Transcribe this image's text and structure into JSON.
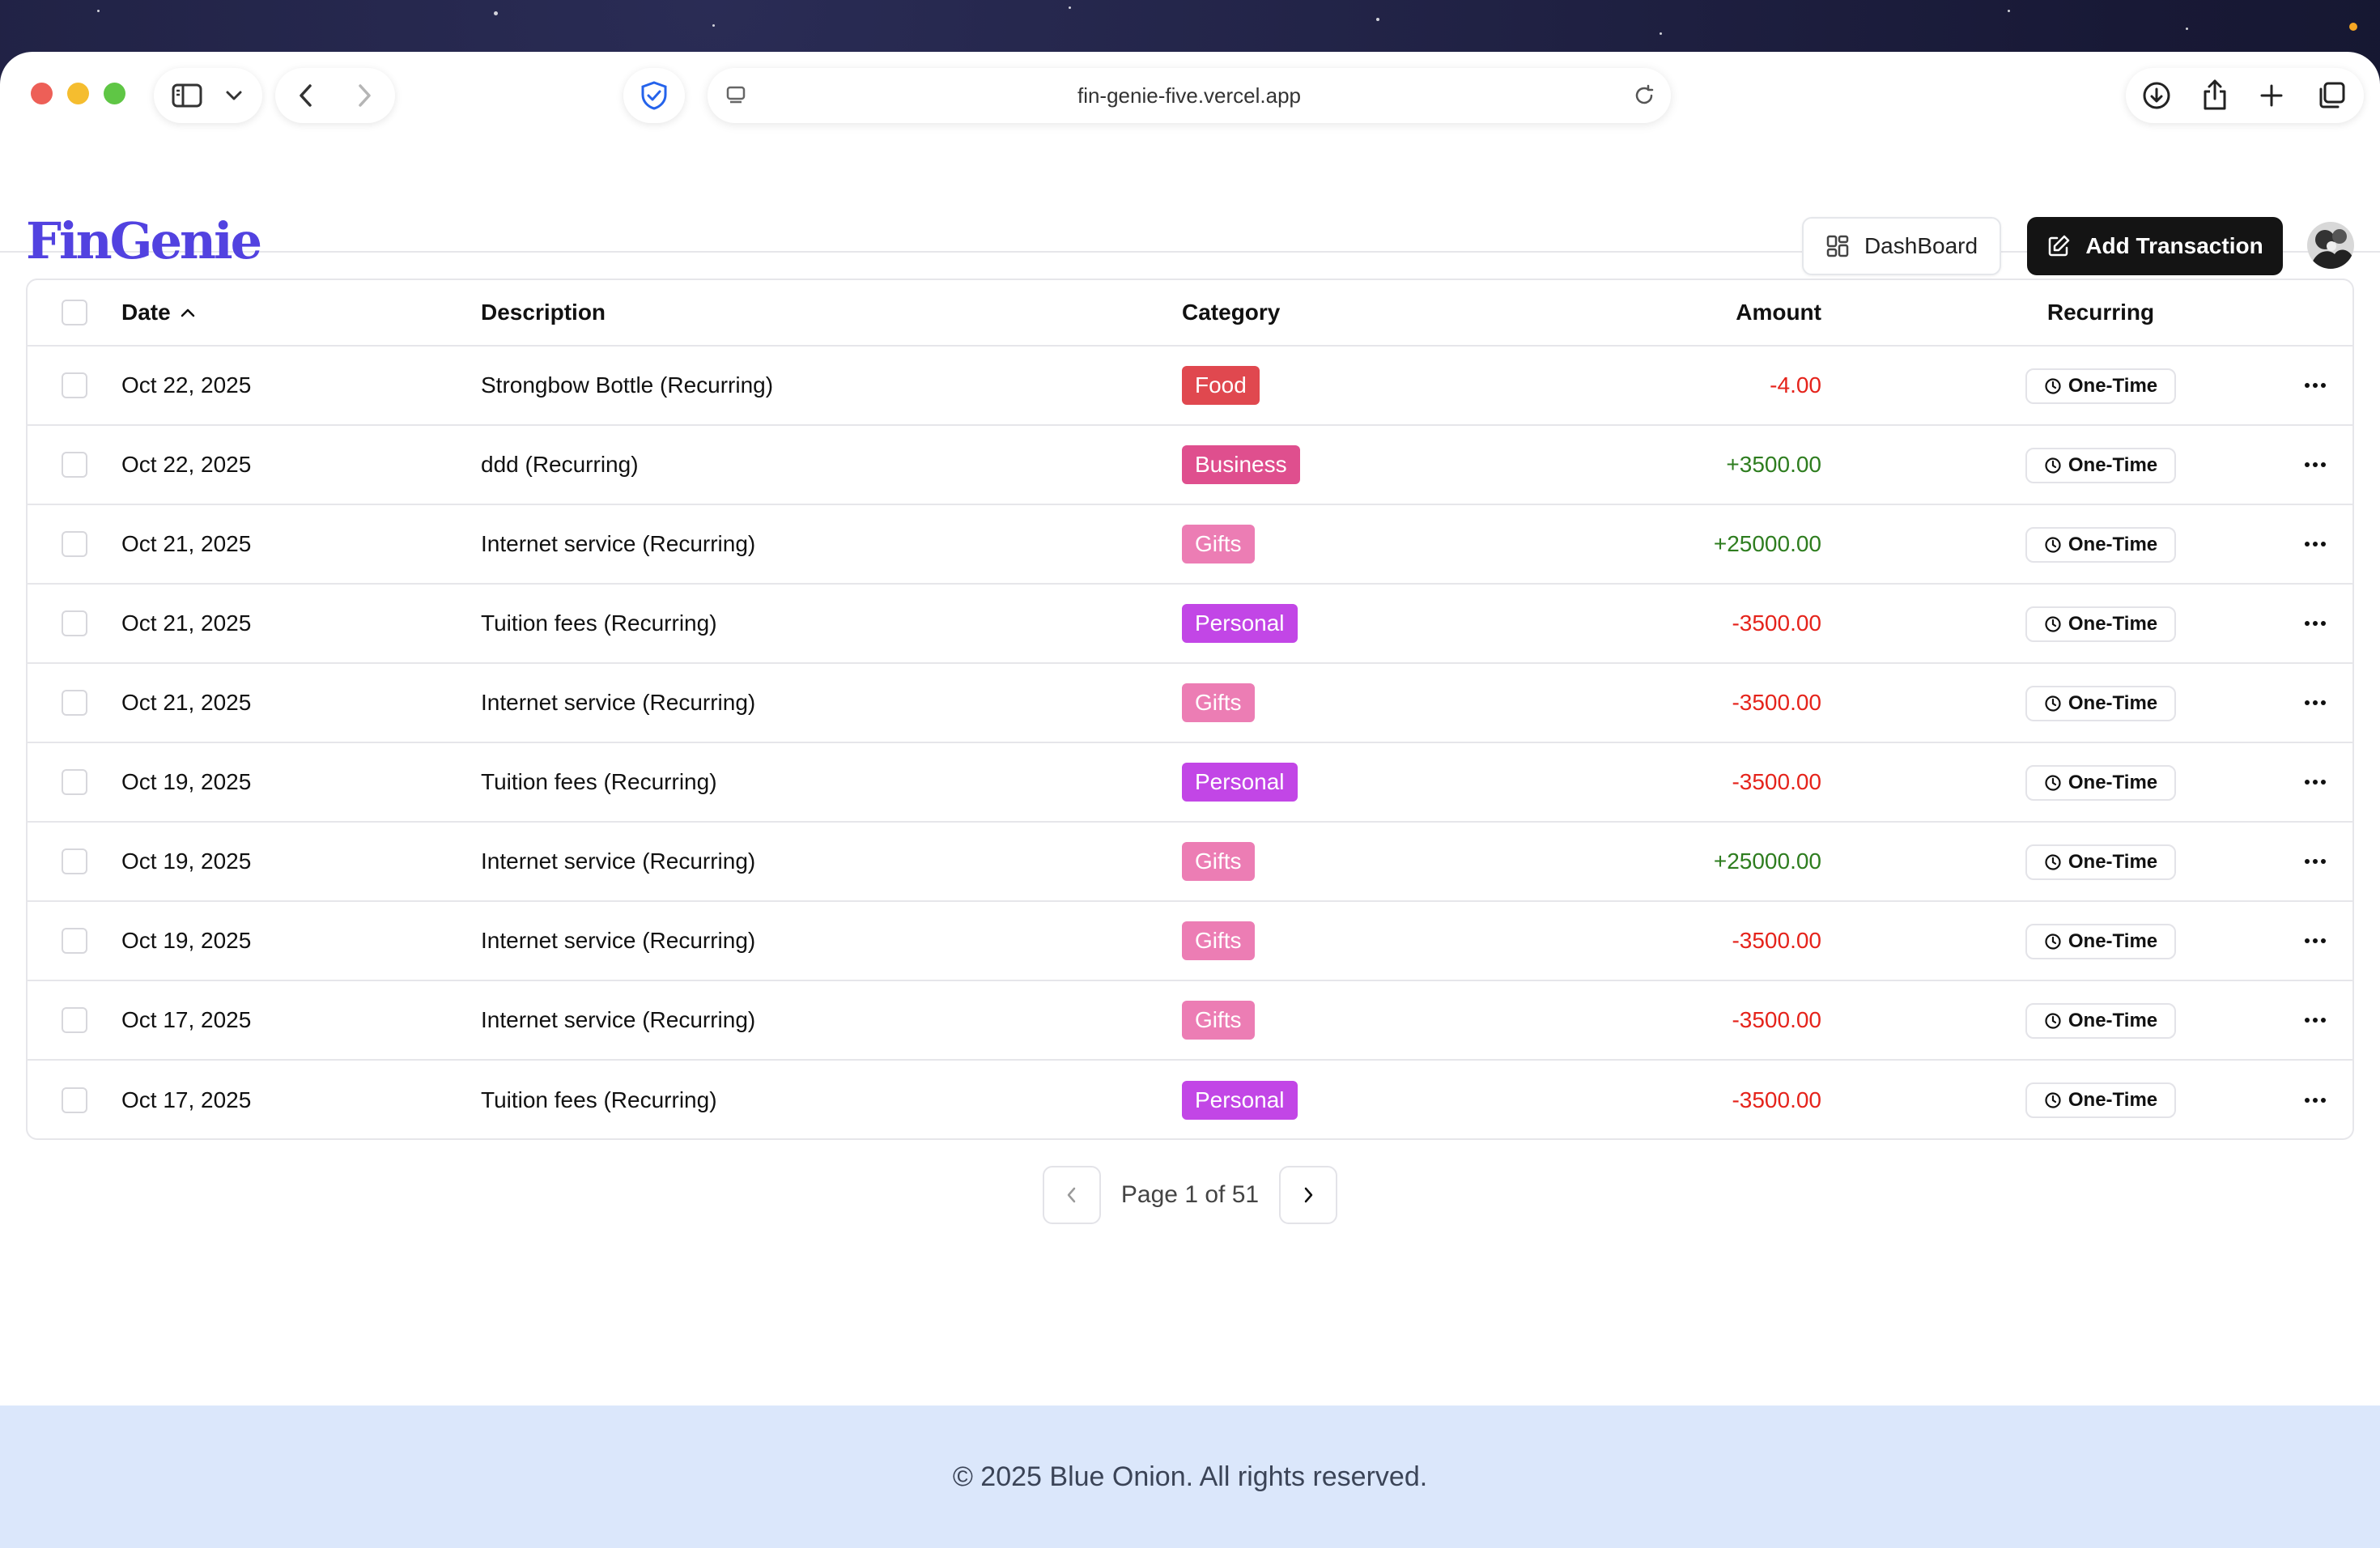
{
  "browser": {
    "url": "fin-genie-five.vercel.app"
  },
  "header": {
    "logo": "FinGenie",
    "dashboard_label": "DashBoard",
    "add_label": "Add Transaction"
  },
  "table": {
    "columns": {
      "date": "Date",
      "description": "Description",
      "category": "Category",
      "amount": "Amount",
      "recurring": "Recurring"
    },
    "rows": [
      {
        "date": "Oct 22, 2025",
        "description": "Strongbow Bottle (Recurring)",
        "category": "Food",
        "category_color": "#e0484f",
        "amount": "-4.00",
        "amount_type": "negative",
        "recurring": "One-Time"
      },
      {
        "date": "Oct 22, 2025",
        "description": "ddd (Recurring)",
        "category": "Business",
        "category_color": "#df4f8e",
        "amount": "+3500.00",
        "amount_type": "positive",
        "recurring": "One-Time"
      },
      {
        "date": "Oct 21, 2025",
        "description": "Internet service (Recurring)",
        "category": "Gifts",
        "category_color": "#ec7db4",
        "amount": "+25000.00",
        "amount_type": "positive",
        "recurring": "One-Time"
      },
      {
        "date": "Oct 21, 2025",
        "description": "Tuition fees (Recurring)",
        "category": "Personal",
        "category_color": "#c246e6",
        "amount": "-3500.00",
        "amount_type": "negative",
        "recurring": "One-Time"
      },
      {
        "date": "Oct 21, 2025",
        "description": "Internet service (Recurring)",
        "category": "Gifts",
        "category_color": "#ec7db4",
        "amount": "-3500.00",
        "amount_type": "negative",
        "recurring": "One-Time"
      },
      {
        "date": "Oct 19, 2025",
        "description": "Tuition fees (Recurring)",
        "category": "Personal",
        "category_color": "#c246e6",
        "amount": "-3500.00",
        "amount_type": "negative",
        "recurring": "One-Time"
      },
      {
        "date": "Oct 19, 2025",
        "description": "Internet service (Recurring)",
        "category": "Gifts",
        "category_color": "#ec7db4",
        "amount": "+25000.00",
        "amount_type": "positive",
        "recurring": "One-Time"
      },
      {
        "date": "Oct 19, 2025",
        "description": "Internet service (Recurring)",
        "category": "Gifts",
        "category_color": "#ec7db4",
        "amount": "-3500.00",
        "amount_type": "negative",
        "recurring": "One-Time"
      },
      {
        "date": "Oct 17, 2025",
        "description": "Internet service (Recurring)",
        "category": "Gifts",
        "category_color": "#ec7db4",
        "amount": "-3500.00",
        "amount_type": "negative",
        "recurring": "One-Time"
      },
      {
        "date": "Oct 17, 2025",
        "description": "Tuition fees (Recurring)",
        "category": "Personal",
        "category_color": "#c246e6",
        "amount": "-3500.00",
        "amount_type": "negative",
        "recurring": "One-Time"
      }
    ]
  },
  "pagination": {
    "label": "Page 1 of 51"
  },
  "footer": {
    "text": "© 2025 Blue Onion. All rights reserved."
  },
  "colors": {
    "negative": "#e5231b",
    "positive": "#2e7d1f",
    "brand": "#5242e0"
  },
  "icons": [
    "sidebar-icon",
    "chevron-down-icon",
    "back-icon",
    "forward-icon",
    "shield-icon",
    "page-icon",
    "reload-icon",
    "download-icon",
    "share-icon",
    "plus-icon",
    "tabs-icon",
    "dashboard-grid-icon",
    "edit-icon",
    "sort-up-icon",
    "clock-icon",
    "more-icon",
    "chevron-left-icon",
    "chevron-right-icon"
  ]
}
